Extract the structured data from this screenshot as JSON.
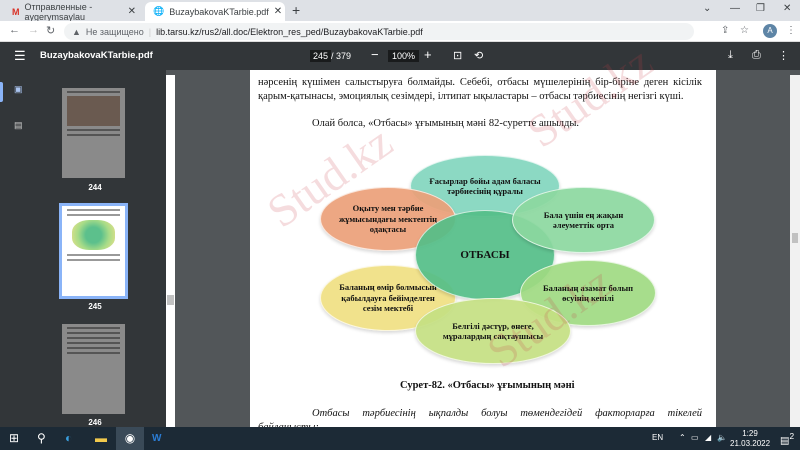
{
  "browser": {
    "tabs": [
      {
        "label": "Отправленные - aygerymsaylau",
        "icon": "gmail-icon"
      },
      {
        "label": "BuzaybakovaKTarbie.pdf",
        "icon": "globe-icon"
      }
    ],
    "security": "Не защищено",
    "url": "lib.tarsu.kz/rus2/all.doc/Elektron_res_ped/BuzaybakovaKTarbie.pdf",
    "avatar": "A"
  },
  "pdf": {
    "title": "BuzaybakovaKTarbie.pdf",
    "page": "245",
    "total": "/ 379",
    "zoom": "100%",
    "thumbnails": [
      "244",
      "245",
      "246"
    ]
  },
  "doc": {
    "para1": "нәрсенің күшімен салыстыруға болмайды. Себебі, отбасы мүшелерінің бір-біріне деген кісілік қарым-қатынасы, эмоциялық сезімдері, ілтипат ықыластары – отбасы тәрбиесінің негізгі күші.",
    "para2": "Олай болса, «Отбасы» ұғымының мәні 82-суретте ашылды.",
    "diagram": {
      "center": "ОТБАСЫ",
      "items": [
        "Ғасырлар бойы адам баласы тәрбиесінің құралы",
        "Бала үшін ең жақын әлеуметтік орта",
        "Баланың азамат болып өсуінің кепілі",
        "Белгілі дәстүр, өнеге, мұралардың сақтаушысы",
        "Баланың өмір болмысын қабылдауға бейімделген сезім мектебі",
        "Оқыту мен тәрбие жұмысындағы мектептің одақтасы"
      ]
    },
    "caption": "Сурет-82. «Отбасы» ұғымының мәні",
    "para3": "Отбасы тәрбиесінің ықпалды болуы төмендегідей факторларға тікелей байланысты:",
    "watermark": "Stud.kz"
  },
  "taskbar": {
    "lang": "EN",
    "time": "1:29",
    "date": "21.03.2022",
    "notifications": "2"
  }
}
